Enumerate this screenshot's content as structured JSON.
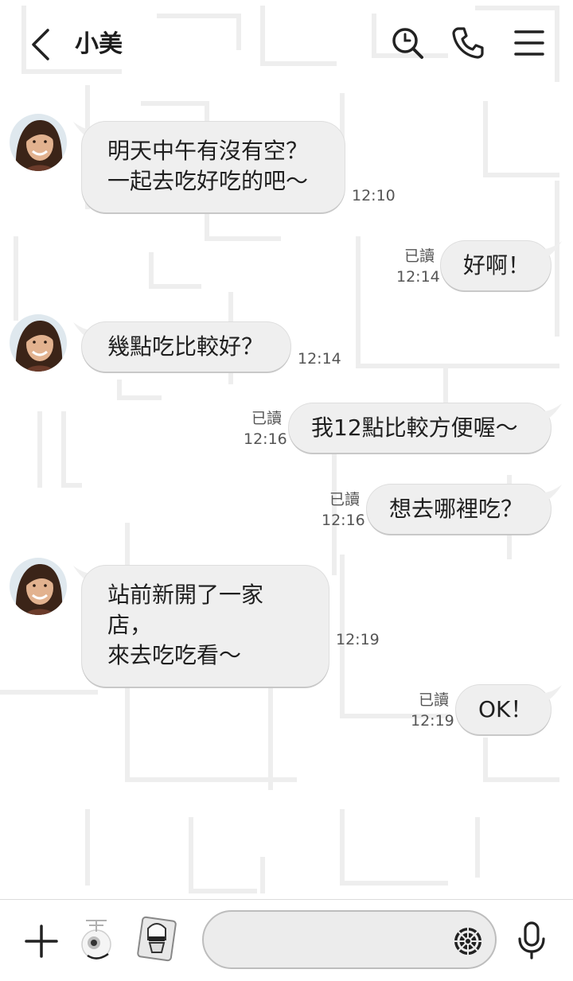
{
  "header": {
    "title": "小美"
  },
  "messages": [
    {
      "side": "left",
      "text": "明天中午有沒有空？\n一起去吃好吃的吧～",
      "time": "12:10"
    },
    {
      "side": "right",
      "text": "好啊！",
      "time": "12:14",
      "read": "已讀"
    },
    {
      "side": "left",
      "text": "幾點吃比較好？",
      "time": "12:14"
    },
    {
      "side": "right",
      "text": "我12點比較方便喔～",
      "time": "12:16",
      "read": "已讀"
    },
    {
      "side": "right",
      "text": "想去哪裡吃？",
      "time": "12:16",
      "read": "已讀"
    },
    {
      "side": "left",
      "text": "站前新開了一家店，\n來去吃吃看～",
      "time": "12:19"
    },
    {
      "side": "right",
      "text": "OK！",
      "time": "12:19",
      "read": "已讀"
    }
  ],
  "input": {
    "value": ""
  },
  "icons": {
    "back": "chevron-left-icon",
    "search": "search-history-icon",
    "call": "phone-icon",
    "menu": "hamburger-menu-icon",
    "plus": "plus-icon",
    "camera": "camera-icon",
    "sticker": "sticker-icon",
    "emoji": "emblem-icon",
    "mic": "microphone-icon"
  },
  "colors": {
    "bubble": "#efefef",
    "text": "#1f1f1f",
    "meta": "#555555"
  }
}
